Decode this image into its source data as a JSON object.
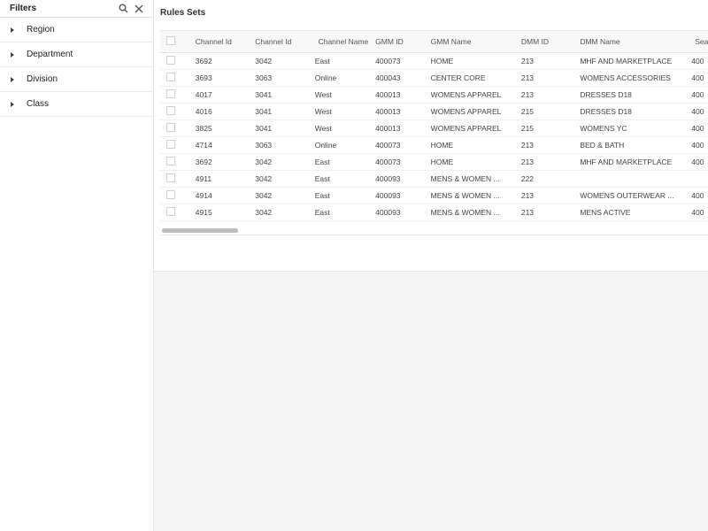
{
  "sidebar": {
    "title": "Filters",
    "items": [
      {
        "label": "Region"
      },
      {
        "label": "Department"
      },
      {
        "label": "Division"
      },
      {
        "label": "Class"
      }
    ]
  },
  "main": {
    "title": "Rules Sets",
    "columns": [
      "Channel Id",
      "Channel Id",
      "Channel Name",
      "GMM ID",
      "GMM Name",
      "DMM ID",
      "DMM Name",
      "Sea Bu"
    ],
    "rows": [
      [
        "3692",
        "3042",
        "East",
        "400073",
        "HOME",
        "213",
        "MHF AND MARKETPLACE",
        "400"
      ],
      [
        "3693",
        "3063",
        "Online",
        "400043",
        "CENTER CORE",
        "213",
        "WOMENS ACCESSORIES",
        "400"
      ],
      [
        "4017",
        "3041",
        "West",
        "400013",
        "WOMENS APPAREL",
        "213",
        "DRESSES D18",
        "400"
      ],
      [
        "4016",
        "3041",
        "West",
        "400013",
        "WOMENS APPAREL",
        "215",
        "DRESSES D18",
        "400"
      ],
      [
        "3825",
        "3041",
        "West",
        "400013",
        "WOMENS APPAREL",
        "215",
        "WOMENS YC",
        "400"
      ],
      [
        "4714",
        "3063",
        "Online",
        "400073",
        "HOME",
        "213",
        "BED & BATH",
        "400"
      ],
      [
        "3692",
        "3042",
        "East",
        "400073",
        "HOME",
        "213",
        "MHF AND MARKETPLACE",
        "400"
      ],
      [
        "4911",
        "3042",
        "East",
        "400093",
        "MENS & WOMEN ...",
        "222",
        "",
        ""
      ],
      [
        "4914",
        "3042",
        "East",
        "400093",
        "MENS & WOMEN ...",
        "213",
        "WOMENS OUTERWEAR ...",
        "400"
      ],
      [
        "4915",
        "3042",
        "East",
        "400093",
        "MENS & WOMEN ...",
        "213",
        "MENS ACTIVE",
        "400"
      ]
    ]
  }
}
